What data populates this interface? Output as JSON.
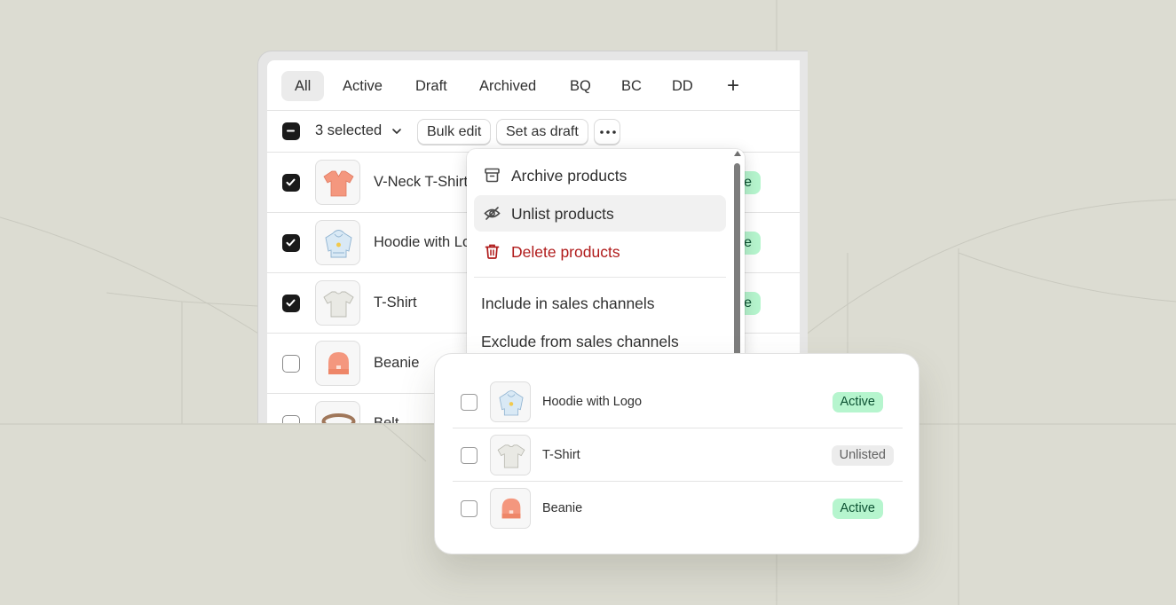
{
  "tabs": [
    {
      "label": "All",
      "selected": true
    },
    {
      "label": "Active"
    },
    {
      "label": "Draft"
    },
    {
      "label": "Archived"
    },
    {
      "label": "BQ"
    },
    {
      "label": "BC"
    },
    {
      "label": "DD"
    }
  ],
  "add_tab_label": "+",
  "bulk_actions": {
    "selected_label": "3 selected",
    "bulk_edit_label": "Bulk edit",
    "set_draft_label": "Set as draft"
  },
  "products": [
    {
      "name": "V-Neck T-Shirt",
      "checked": true,
      "status_partial": "e",
      "icon": "vneck-tshirt-image"
    },
    {
      "name": "Hoodie with Logo",
      "checked": true,
      "status_partial": "e",
      "icon": "hoodie-image"
    },
    {
      "name": "T-Shirt",
      "checked": true,
      "status_partial": "e",
      "icon": "tshirt-image"
    },
    {
      "name": "Beanie",
      "checked": false,
      "icon": "beanie-image"
    },
    {
      "name": "Belt",
      "checked": false,
      "icon": "belt-image"
    }
  ],
  "menu": {
    "items": [
      {
        "label": "Archive products",
        "icon": "archive-icon"
      },
      {
        "label": "Unlist products",
        "icon": "eye-slash-icon",
        "highlighted": true
      },
      {
        "label": "Delete products",
        "icon": "trash-icon",
        "destructive": true
      }
    ],
    "channel_items": [
      {
        "label": "Include in sales channels"
      },
      {
        "label": "Exclude from sales channels"
      }
    ]
  },
  "float_list": [
    {
      "name": "Hoodie with Logo",
      "status": "Active"
    },
    {
      "name": "T-Shirt",
      "status": "Unlisted"
    },
    {
      "name": "Beanie",
      "status": "Active"
    }
  ],
  "colors": {
    "background": "#dcdcd2",
    "active_badge": "#b6f5ce",
    "active_badge_text": "#0c5132",
    "unlisted_badge": "#ececec",
    "destructive": "#b01b1b",
    "product_orange": "#f4977e"
  }
}
